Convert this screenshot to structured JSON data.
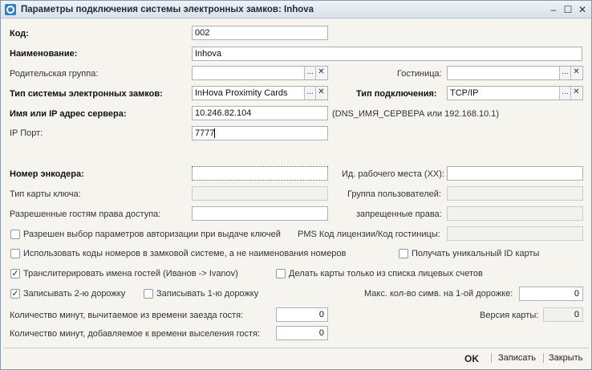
{
  "window": {
    "title": "Параметры подключения системы электронных замков: Inhova",
    "controls": [
      "‒",
      "☐",
      "✕"
    ]
  },
  "form": {
    "code": {
      "label": "Код:",
      "value": "002"
    },
    "name": {
      "label": "Наименование:",
      "value": "Inhova"
    },
    "parent_group": {
      "label": "Родительская группа:",
      "value": ""
    },
    "hotel": {
      "label": "Гостиница:",
      "value": ""
    },
    "lock_system_type": {
      "label": "Тип системы электронных замков:",
      "value": "InHova Proximity Cards"
    },
    "connection_type": {
      "label": "Тип подключения:",
      "value": "TCP/IP"
    },
    "server": {
      "label": "Имя или IP адрес сервера:",
      "value": "10.246.82.104",
      "hint": "(DNS_ИМЯ_СЕРВЕРА или 192.168.10.1)"
    },
    "ip_port": {
      "label": "IP Порт:",
      "value": "7777"
    },
    "encoder_number": {
      "label": "Номер энкодера:",
      "value": ""
    },
    "workplace_id": {
      "label": "Ид. рабочего места (XX):",
      "value": ""
    },
    "key_card_type": {
      "label": "Тип карты ключа:",
      "value": ""
    },
    "user_group": {
      "label": "Группа пользователей:",
      "value": ""
    },
    "guest_access_rights": {
      "label": "Разрешенные гостям права доступа:",
      "value": ""
    },
    "forbidden_rights": {
      "label": "запрещенные права:",
      "value": ""
    },
    "pms_license": {
      "label": "PMS Код лицензии/Код гостиницы:",
      "value": ""
    },
    "max_chars_track1": {
      "label": "Макс. кол-во симв. на 1-ой дорожке:",
      "value": "0"
    },
    "card_version": {
      "label": "Версия карты:",
      "value": "0"
    },
    "minutes_subtract": {
      "label": "Количество минут, вычитаемое из времени заезда гостя:",
      "value": "0"
    },
    "minutes_add": {
      "label": "Количество минут, добавляемое к времени выселения гостя:",
      "value": "0"
    }
  },
  "checkboxes": {
    "auth_params": {
      "label": "Разрешен выбор параметров авторизации при выдаче ключей",
      "checked": false
    },
    "use_room_codes": {
      "label": "Использовать коды номеров в замковой системе, а не наименования номеров",
      "checked": false
    },
    "unique_card_id": {
      "label": "Получать уникальный ID карты",
      "checked": false
    },
    "transliterate": {
      "label": "Транслитерировать имена гостей (Иванов -> Ivanov)",
      "checked": true
    },
    "only_account_list": {
      "label": "Делать карты только из списка лицевых счетов",
      "checked": false
    },
    "write_track2": {
      "label": "Записывать 2-ю дорожку",
      "checked": true
    },
    "write_track1": {
      "label": "Записывать 1-ю дорожку",
      "checked": false
    }
  },
  "buttons": {
    "choose": "...",
    "clear": "✕",
    "ok": "OK",
    "save": "Записать",
    "close": "Закрыть"
  },
  "colors": {
    "titlebar": "#dce6ee",
    "window_bg": "#f5f4ee",
    "field_border": "#a9b2bb"
  }
}
